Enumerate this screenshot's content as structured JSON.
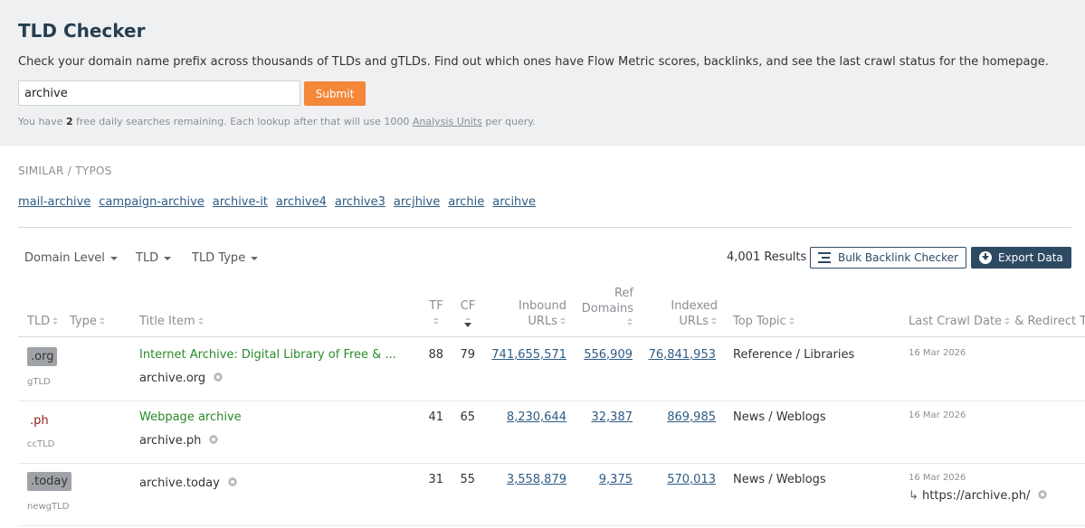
{
  "header": {
    "title": "TLD Checker",
    "description": "Check your domain name prefix across thousands of TLDs and gTLDs. Find out which ones have Flow Metric scores, backlinks, and see the last crawl status for the homepage.",
    "search_value": "archive",
    "submit_label": "Submit",
    "quota_prefix": "You have ",
    "quota_count": "2",
    "quota_middle": " free daily searches remaining. Each lookup after that will use 1000 ",
    "quota_link": "Analysis Units",
    "quota_suffix": " per query."
  },
  "similar": {
    "label": "SIMILAR / TYPOS",
    "items": [
      "mail-archive",
      "campaign-archive",
      "archive-it",
      "archive4",
      "archive3",
      "arcjhive",
      "archie",
      "arcihve"
    ]
  },
  "filters": {
    "domain_level": "Domain Level",
    "tld": "TLD",
    "tld_type": "TLD Type"
  },
  "toolbar": {
    "results": "4,001 Results",
    "bulk_label": "Bulk Backlink Checker",
    "export_label": "Export Data"
  },
  "columns": {
    "tld": "TLD",
    "type": "Type",
    "title": "Title",
    "item": "Item",
    "tf": "TF",
    "cf": "CF",
    "inbound_1": "Inbound",
    "inbound_2": "URLs",
    "ref_1": "Ref",
    "ref_2": "Domains",
    "indexed_1": "Indexed",
    "indexed_2": "URLs",
    "topic": "Top Topic",
    "crawl": "Last Crawl Date",
    "redirect": "& Redirect To"
  },
  "rows": [
    {
      "tld": ".org",
      "tld_type": "gTLD",
      "title": "Internet Archive: Digital Library of Free & ...",
      "domain": "archive.org",
      "tf": "88",
      "cf": "79",
      "inbound": "741,655,571",
      "ref": "556,909",
      "indexed": "76,841,953",
      "topic": "Reference / Libraries",
      "date": "16 Mar 2026",
      "redirect": ""
    },
    {
      "tld": ".ph",
      "tld_type": "ccTLD",
      "title": "Webpage archive",
      "domain": "archive.ph",
      "tf": "41",
      "cf": "65",
      "inbound": "8,230,644",
      "ref": "32,387",
      "indexed": "869,985",
      "topic": "News / Weblogs",
      "date": "16 Mar 2026",
      "redirect": ""
    },
    {
      "tld": ".today",
      "tld_type": "newgTLD",
      "title": "",
      "domain": "archive.today",
      "tf": "31",
      "cf": "55",
      "inbound": "3,558,879",
      "ref": "9,375",
      "indexed": "570,013",
      "topic": "News / Weblogs",
      "date": "16 Mar 2026",
      "redirect": "https://archive.ph/"
    }
  ],
  "colors": {
    "brand": "#263e50",
    "accent": "#f4873a",
    "link": "#2e5b84",
    "title_green": "#2a8a2a"
  }
}
